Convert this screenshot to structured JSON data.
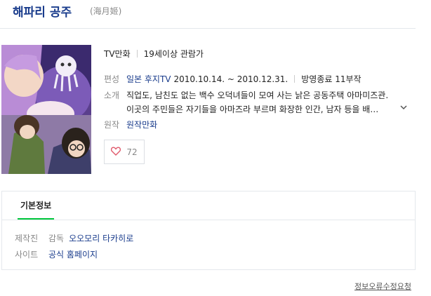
{
  "header": {
    "title": "해파리 공주",
    "original_title": "(海月姬)"
  },
  "meta": {
    "type": "TV만화",
    "rating": "19세이상 관람가"
  },
  "schedule": {
    "label": "편성",
    "broadcaster": "일본 후지TV",
    "period": "2010.10.14. ~ 2010.12.31.",
    "status": "방영종료 11부작"
  },
  "synopsis": {
    "label": "소개",
    "line1": "직업도, 남친도 없는 백수 오덕녀들이 모여 사는 낡은 공동주택 아마미즈관.",
    "line2": "이곳의 주민들은 자기들을 아마즈라 부르며 화장한 인간, 남자 등을 배…"
  },
  "original": {
    "label": "원작",
    "value": "원작만화"
  },
  "like": {
    "count": "72"
  },
  "basic_info": {
    "tab": "기본정보",
    "producer_label": "제작진",
    "director_role": "감독",
    "director_name": "오오모리 타카히로",
    "site_label": "사이트",
    "site_value": "공식 홈페이지"
  },
  "footer": {
    "report": "정보오류수정요청"
  },
  "colors": {
    "link": "#1a3c8c",
    "tab_underline": "#00c73c",
    "heart": "#e05a6c"
  },
  "icons": {
    "like": "heart-icon",
    "expand": "chevron-down-icon"
  }
}
